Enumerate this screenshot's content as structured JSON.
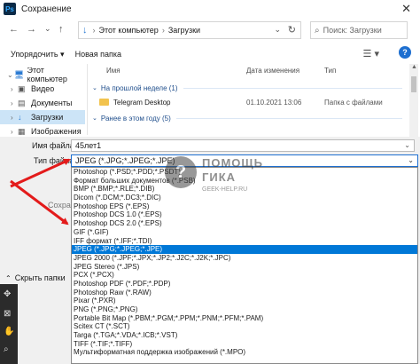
{
  "window": {
    "title": "Сохранение",
    "app_icon_text": "Ps",
    "close_glyph": "✕"
  },
  "address": {
    "back": "←",
    "forward": "→",
    "recent": "⌄",
    "up": "↑",
    "download_glyph": "↓",
    "crumbs": [
      "Этот компьютер",
      "Загрузки"
    ],
    "separator": "›",
    "chevron": "⌄",
    "refresh": "↻"
  },
  "search": {
    "placeholder": "Поиск: Загрузки",
    "glyph": "⌕"
  },
  "toolbar": {
    "organize_label": "Упорядочить ▾",
    "new_folder_label": "Новая папка",
    "view_glyph": "☰ ▾",
    "help_glyph": "?"
  },
  "nav": {
    "items": [
      {
        "label": "Этот компьютер",
        "chev": "⌄",
        "icon": "🖥"
      },
      {
        "label": "Видео",
        "chev": "›",
        "icon": "▣"
      },
      {
        "label": "Документы",
        "chev": "›",
        "icon": "▤"
      },
      {
        "label": "Загрузки",
        "chev": "›",
        "icon": "↓"
      },
      {
        "label": "Изображения",
        "chev": "›",
        "icon": "▦"
      }
    ]
  },
  "filelist": {
    "columns": {
      "name": "Имя",
      "date": "Дата изменения",
      "type": "Тип"
    },
    "groups": [
      {
        "label": "На прошлой неделе (1)",
        "chev": "⌄"
      },
      {
        "label": "Ранее в этом году (5)",
        "chev": "⌄"
      }
    ],
    "rows": [
      {
        "name": "Telegram Desktop",
        "date": "01.10.2021 13:06",
        "type": "Папка с файлами"
      }
    ],
    "scroll_up": "▲"
  },
  "form": {
    "filename_label": "Имя файла:",
    "filename_value": "45лет1",
    "filetype_label": "Тип файла:",
    "filetype_value": "JPEG (*.JPG;*.JPEG;*.JPE)",
    "chevron": "⌄",
    "save_faded": "Сохран",
    "hide_folders": "Скрыть папки",
    "hide_glyph": "⌃"
  },
  "dropdown": {
    "highlighted_index": 12,
    "options": [
      "Photoshop (*.PSD;*.PDD;*.PSDT)",
      "Формат больших документов (*.PSB)",
      "BMP (*.BMP;*.RLE;*.DIB)",
      "Dicom (*.DCM;*.DC3;*.DIC)",
      "Photoshop EPS (*.EPS)",
      "Photoshop DCS 1.0 (*.EPS)",
      "Photoshop DCS 2.0 (*.EPS)",
      "GIF (*.GIF)",
      "IFF формат (*.IFF;*.TDI)",
      "JPEG (*.JPG;*.JPEG;*.JPE)",
      "JPEG 2000 (*.JPF;*.JPX;*.JP2;*.J2C;*.J2K;*.JPC)",
      "JPEG Stereo (*.JPS)",
      "PCX (*.PCX)",
      "Photoshop PDF (*.PDF;*.PDP)",
      "Photoshop Raw (*.RAW)",
      "Pixar (*.PXR)",
      "PNG (*.PNG;*.PNG)",
      "Portable Bit Map (*.PBM;*.PGM;*.PPM;*.PNM;*.PFM;*.PAM)",
      "Scitex CT (*.SCT)",
      "Targa (*.TGA;*.VDA;*.ICB;*.VST)",
      "TIFF (*.TIF;*.TIFF)",
      "Мультиформатная поддержка изображений (*.MPO)"
    ]
  },
  "watermark": {
    "logo": "?",
    "line1": "ПОМОЩЬ",
    "line2": "ГИКА",
    "line3": "GEEK-HELP.RU"
  },
  "colors": {
    "accent": "#0078d7",
    "arrow": "#e31b1b",
    "folder": "#f2c34e"
  }
}
